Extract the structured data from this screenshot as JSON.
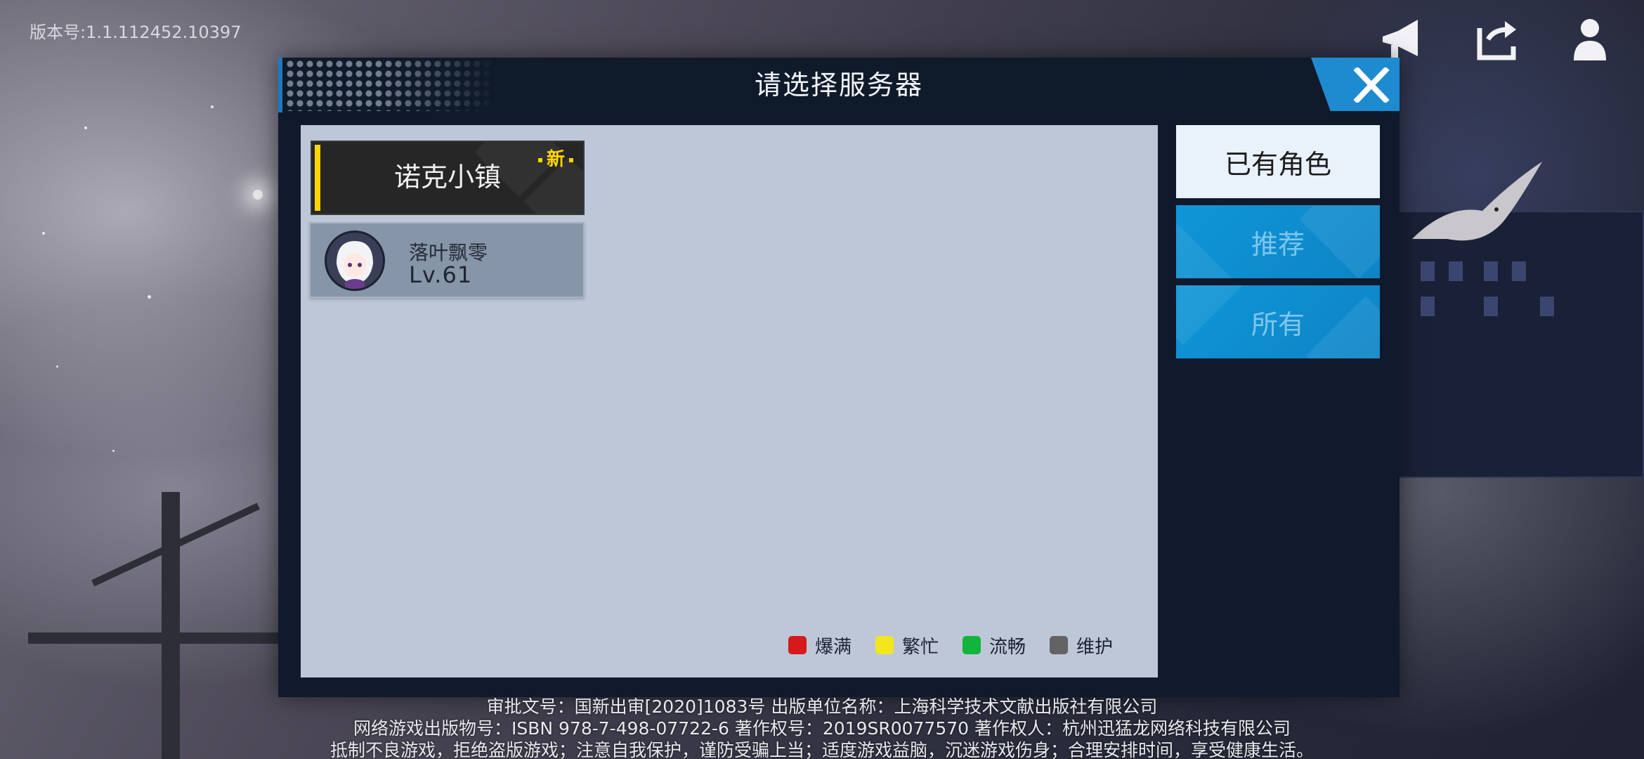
{
  "version_label": "版本号:1.1.112452.10397",
  "top_icons": {
    "announcement": "megaphone-icon",
    "switch_account": "switch-icon",
    "account": "user-icon"
  },
  "dialog": {
    "title": "请选择服务器",
    "close_icon": "close-icon",
    "server": {
      "name": "诺克小镇",
      "badge": "新"
    },
    "character": {
      "name": "落叶飘零",
      "level": "Lv.61"
    },
    "legend": [
      {
        "label": "爆满",
        "color": "#d7191c"
      },
      {
        "label": "繁忙",
        "color": "#f2e61c"
      },
      {
        "label": "流畅",
        "color": "#10b53c"
      },
      {
        "label": "维护",
        "color": "#636363"
      }
    ],
    "tabs": [
      {
        "label": "已有角色",
        "active": true
      },
      {
        "label": "推荐",
        "active": false
      },
      {
        "label": "所有",
        "active": false
      }
    ]
  },
  "footer": {
    "line1": "审批文号：国新出审[2020]1083号    出版单位名称：上海科学技术文献出版社有限公司",
    "line2": "网络游戏出版物号：ISBN 978-7-498-07722-6    著作权号：2019SR0077570    著作权人：杭州迅猛龙网络科技有限公司",
    "line3": "抵制不良游戏，拒绝盗版游戏；注意自我保护，谨防受骗上当；适度游戏益脑，沉迷游戏伤身；合理安排时间，享受健康生活。"
  }
}
